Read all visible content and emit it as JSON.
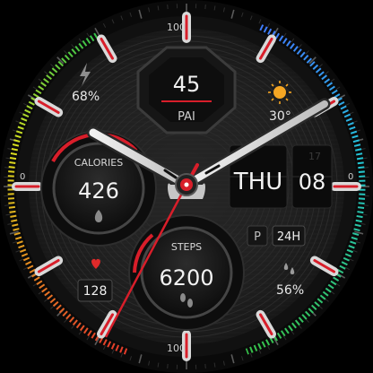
{
  "watch": {
    "bezel": {
      "label_top": "100",
      "label_bottom": "100",
      "label_left": "0",
      "label_right": "0"
    },
    "battery": {
      "icon": "lightning-icon",
      "value": "68%"
    },
    "weather": {
      "icon": "sun-icon",
      "value": "30°"
    },
    "pai": {
      "value": "45",
      "label": "PAI"
    },
    "calories": {
      "label": "CALORIES",
      "value": "426",
      "icon": "flame-icon"
    },
    "steps": {
      "label": "STEPS",
      "value": "6200",
      "icon": "footprints-icon"
    },
    "date": {
      "weekday": "THU",
      "day": "08",
      "day_prev": "17"
    },
    "time_format": {
      "pm_indicator": "P",
      "format": "24H"
    },
    "heart_rate": {
      "icon": "heart-icon",
      "value": "128"
    },
    "humidity": {
      "icon": "drops-icon",
      "value": "56%"
    },
    "colors": {
      "accent_red": "#d81e2a",
      "text": "#e8e8e8",
      "dim_text": "#9a9a9a",
      "gauge_green": "#36c24a",
      "gauge_cyan": "#22c7d8",
      "gauge_yellow": "#e6d21e"
    }
  }
}
